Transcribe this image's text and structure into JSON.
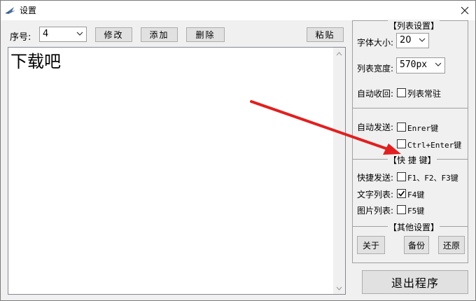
{
  "window": {
    "title": "设置"
  },
  "toolbar": {
    "seq_label": "序号:",
    "seq_value": "4",
    "edit_label": "修改",
    "add_label": "添加",
    "delete_label": "删除",
    "paste_label": "粘贴"
  },
  "editor": {
    "text": "下载吧"
  },
  "list_settings": {
    "title": "【列表设置】",
    "font_size_label": "字体大小:",
    "font_size_value": "20",
    "width_label": "列表宽度:",
    "width_value": "570px",
    "auto_collapse_label": "自动收回:",
    "pin_list_label": "列表常驻",
    "pin_list_checked": false,
    "auto_send_label": "自动发送:",
    "enter_label": "Enrer键",
    "enter_checked": false,
    "ctrl_enter_label": "Ctrl+Enter键",
    "ctrl_enter_checked": false
  },
  "hotkeys": {
    "title": "【快 捷 键】",
    "quick_send_label": "快捷发送:",
    "f1_f3_label": "F1、F2、F3键",
    "f1_f3_checked": false,
    "text_list_label": "文字列表:",
    "f4_label": "F4键",
    "f4_checked": true,
    "image_list_label": "图片列表:",
    "f5_label": "F5键",
    "f5_checked": false
  },
  "other": {
    "title": "【其他设置】",
    "about_label": "关于",
    "backup_label": "备份",
    "restore_label": "还原"
  },
  "exit": {
    "label": "退出程序"
  },
  "colors": {
    "annotation_arrow": "#e02020",
    "check_mark": "#000000"
  }
}
